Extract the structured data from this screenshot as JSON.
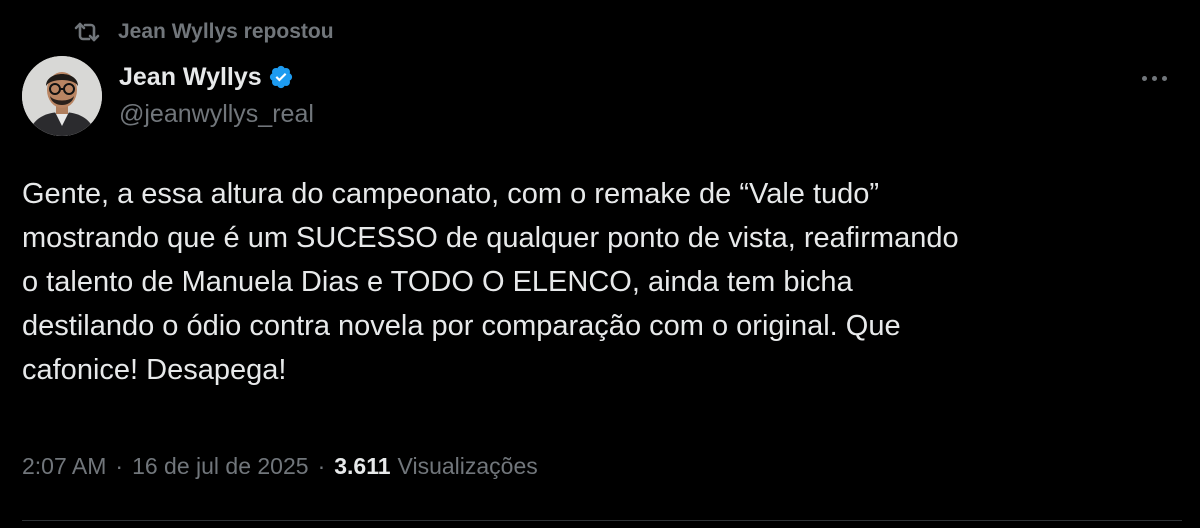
{
  "repost": {
    "icon": "repost-icon",
    "text": "Jean Wyllys repostou"
  },
  "author": {
    "display_name": "Jean Wyllys",
    "handle": "@jeanwyllys_real",
    "verified_icon": "verified-badge-icon",
    "verified_color": "#1d9bf0"
  },
  "more_icon": "more-options-icon",
  "tweet": {
    "text": "Gente, a essa altura do campeonato, com o remake de “Vale tudo”\nmostrando que é um SUCESSO de qualquer ponto de vista, reafirmando\no talento de Manuela Dias e TODO O ELENCO, ainda tem bicha\ndestilando o ódio contra novela por comparação com o original. Que\ncafonice! Desapega!"
  },
  "meta": {
    "time": "2:07 AM",
    "separator": "·",
    "date": "16 de jul de 2025",
    "views_count": "3.611",
    "views_label": "Visualizações"
  },
  "colors": {
    "background": "#000000",
    "primary_text": "#e7e9ea",
    "secondary_text": "#71767b",
    "divider": "#2f3336"
  }
}
